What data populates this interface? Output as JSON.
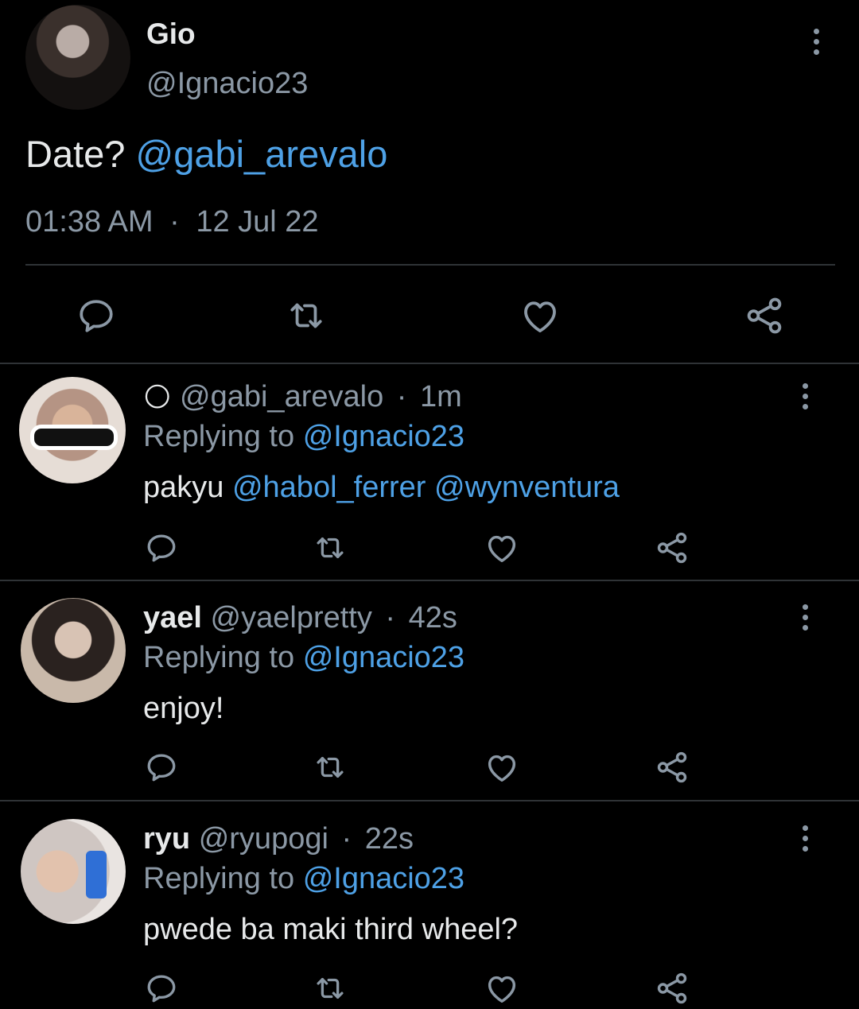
{
  "main_tweet": {
    "display_name": "Gio",
    "handle": "@Ignacio23",
    "text_plain": "Date?",
    "text_mention": "@gabi_arevalo",
    "time": "01:38 AM",
    "separator": "·",
    "date": "12 Jul 22"
  },
  "replies": [
    {
      "display_name": "",
      "emoji": "🌕",
      "handle": "@gabi_arevalo",
      "separator": "·",
      "age": "1m",
      "replying_prefix": "Replying to",
      "replying_to": "@Ignacio23",
      "text_plain": "pakyu",
      "mentions": "@habol_ferrer @wynventura"
    },
    {
      "display_name": "yael",
      "handle": "@yaelpretty",
      "separator": "·",
      "age": "42s",
      "replying_prefix": "Replying to",
      "replying_to": "@Ignacio23",
      "text_plain": "enjoy!"
    },
    {
      "display_name": "ryu",
      "handle": "@ryupogi",
      "separator": "·",
      "age": "22s",
      "replying_prefix": "Replying to",
      "replying_to": "@Ignacio23",
      "text_plain": "pwede ba maki third wheel?"
    }
  ],
  "icons": [
    "more-icon",
    "reply-icon",
    "retweet-icon",
    "like-icon",
    "share-icon"
  ],
  "colors": {
    "background": "#000000",
    "text": "#e7e9ea",
    "muted": "#8b98a5",
    "link": "#4ea1e6"
  }
}
